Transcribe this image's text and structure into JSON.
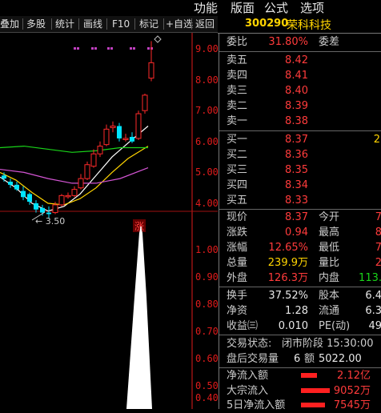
{
  "menu": {
    "items": [
      "功能",
      "版面",
      "公式",
      "选项"
    ]
  },
  "toolbar": {
    "items": [
      "叠加",
      "多股",
      "统计",
      "画线",
      "F10",
      "标记",
      "+自选",
      "返回"
    ]
  },
  "stock": {
    "code": "300290",
    "name": "荣科科技"
  },
  "chart": {
    "price_ticks": [
      "9.00",
      "8.00",
      "7.00",
      "6.00",
      "5.00",
      "4.00"
    ],
    "volume_ticks": [
      "1.00",
      "0.90",
      "0.80",
      "0.70",
      "0.60",
      "0.50",
      "0.40"
    ],
    "low_label": "3.50",
    "limit_up_badge": "涨",
    "colors": {
      "up": "#ff2a2a",
      "down": "#00e4ff",
      "ma5": "#ffffff",
      "ma10": "#ffd400",
      "ma20": "#19d419",
      "ma30": "#d455d4",
      "marker": "#c040c0"
    }
  },
  "order": {
    "webi_label": "委比",
    "webi_value": "31.80%",
    "weicha_label": "委差",
    "weicha_value": "",
    "sell": [
      {
        "label": "卖五",
        "price": "8.42"
      },
      {
        "label": "卖四",
        "price": "8.41"
      },
      {
        "label": "卖三",
        "price": "8.40"
      },
      {
        "label": "卖二",
        "price": "8.39"
      },
      {
        "label": "卖一",
        "price": "8.38"
      }
    ],
    "buy": [
      {
        "label": "买一",
        "price": "8.37",
        "vol": "2"
      },
      {
        "label": "买二",
        "price": "8.36",
        "vol": ""
      },
      {
        "label": "买三",
        "price": "8.35",
        "vol": ""
      },
      {
        "label": "买四",
        "price": "8.34",
        "vol": ""
      },
      {
        "label": "买五",
        "price": "8.33",
        "vol": ""
      }
    ]
  },
  "quote": {
    "xianjia_label": "现价",
    "xianjia": "8.37",
    "jinkai_label": "今开",
    "jinkai": "7",
    "zhangdie_label": "涨跌",
    "zhangdie": "0.94",
    "zuigao_label": "最高",
    "zuigao": "8",
    "zhangfu_label": "涨幅",
    "zhangfu": "12.65%",
    "zuidi_label": "最低",
    "zuidi": "7",
    "zongliang_label": "总量",
    "zongliang": "239.9万",
    "liangbi_label": "量比",
    "liangbi": "2",
    "waipan_label": "外盘",
    "waipan": "126.3万",
    "neipan_label": "内盘",
    "neipan": "113."
  },
  "stats": {
    "huanshou_label": "换手",
    "huanshou": "37.52%",
    "guben_label": "股本",
    "guben": "6.4",
    "jingzi_label": "净资",
    "jingzi": "1.28",
    "liutong_label": "流通",
    "liutong": "6.3",
    "shouyi_label": "收益㈢",
    "shouyi": "0.010",
    "pe_label": "PE(动)",
    "pe": "49"
  },
  "trade": {
    "status_label": "交易状态:",
    "status_value": "闭市阶段 15:30:00",
    "after_label": "盘后交易量",
    "after_vol": "6",
    "after_amt_label": "额",
    "after_amt": "5022.00"
  },
  "flow": [
    {
      "label": "净流入额",
      "value": "2.12亿",
      "bar_frac": 0.5
    },
    {
      "label": "大宗流入",
      "value": "9052万",
      "bar_frac": 0.9
    },
    {
      "label": "5日净流入额",
      "value": "7545万",
      "bar_frac": 0.75
    }
  ]
}
